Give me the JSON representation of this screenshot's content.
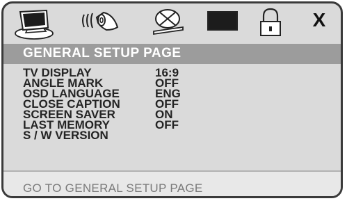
{
  "menu": {
    "tabs": [
      {
        "name": "general-setup",
        "icon": "tv-monitor-icon",
        "selected": true
      },
      {
        "name": "audio-setup",
        "icon": "speaker-icon"
      },
      {
        "name": "dolby-setup",
        "icon": "dolby-disc-icon"
      },
      {
        "name": "video-setup",
        "icon": "video-screen-icon"
      },
      {
        "name": "password-setup",
        "icon": "padlock-icon"
      },
      {
        "name": "exit",
        "icon": "exit-x-icon",
        "label": "X"
      }
    ]
  },
  "page": {
    "title": "GENERAL SETUP PAGE",
    "settings": [
      {
        "label": "TV DISPLAY",
        "value": "16:9"
      },
      {
        "label": "ANGLE MARK",
        "value": "OFF"
      },
      {
        "label": "OSD LANGUAGE",
        "value": "ENG"
      },
      {
        "label": "CLOSE CAPTION",
        "value": "OFF"
      },
      {
        "label": "SCREEN SAVER",
        "value": "ON"
      },
      {
        "label": "LAST MEMORY",
        "value": "OFF"
      },
      {
        "label": "S / W VERSION",
        "value": ""
      }
    ]
  },
  "footer": {
    "hint": "GO TO GENERAL SETUP PAGE"
  },
  "colors": {
    "panel": "#dadada",
    "title_bar": "#9c9c9c",
    "footer": "#e8e8e8",
    "text": "#242424",
    "hint_text": "#7a7a7a"
  }
}
